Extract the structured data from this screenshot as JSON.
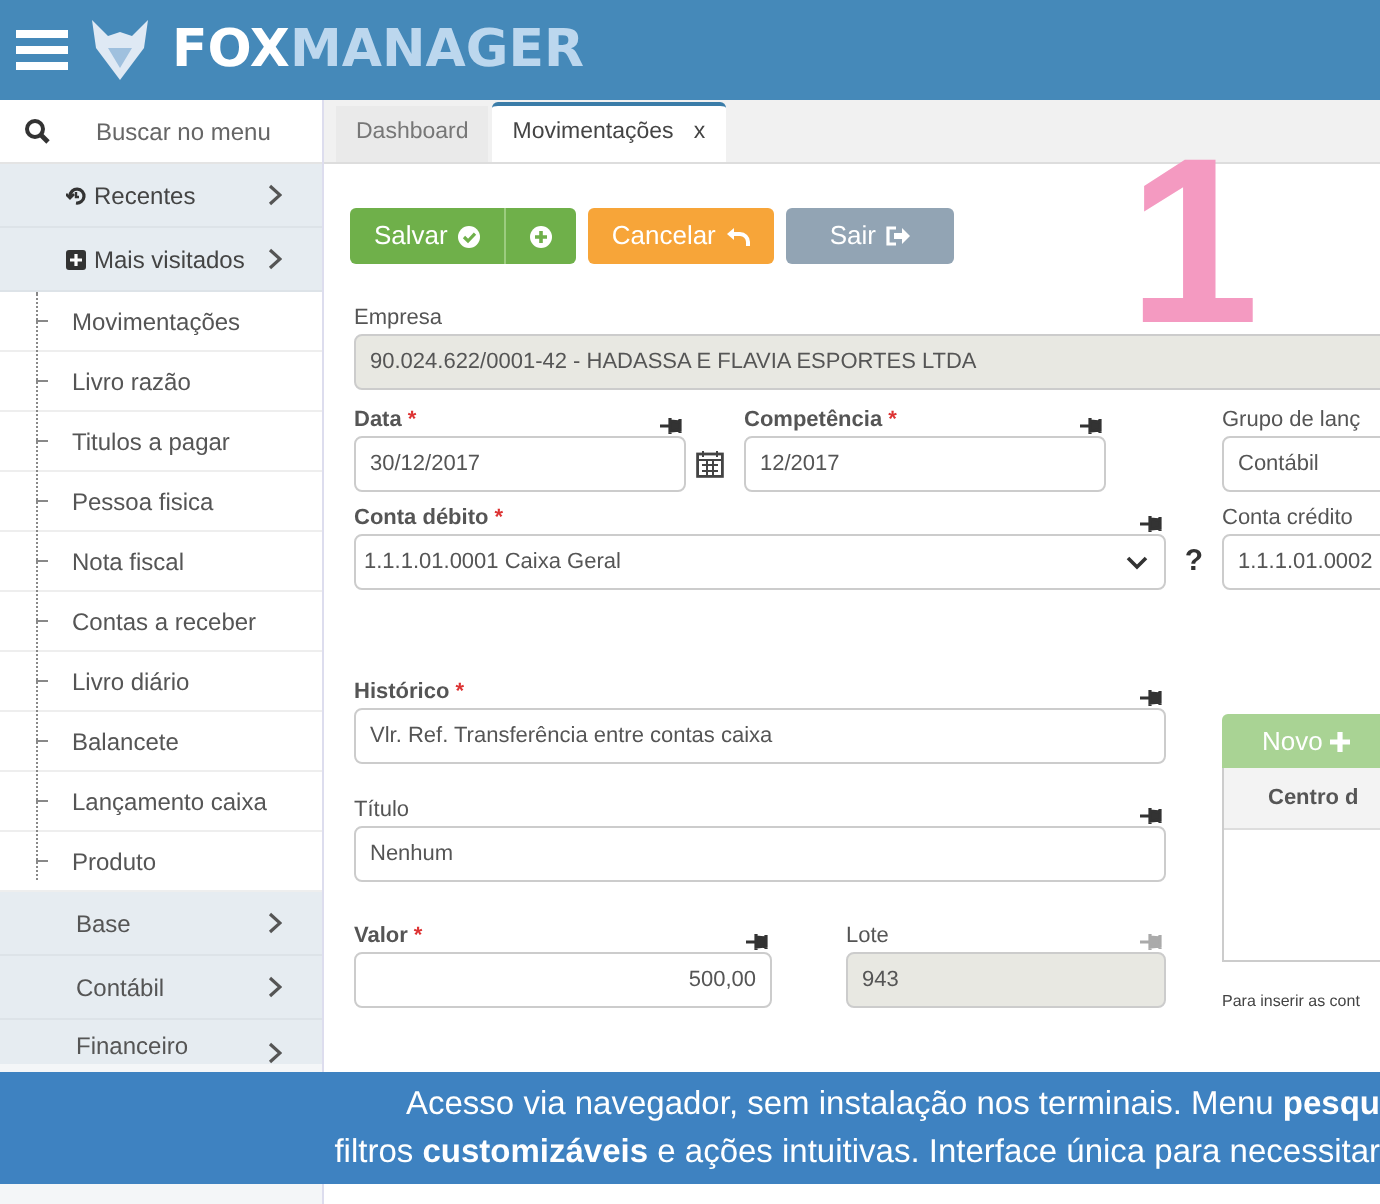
{
  "header": {
    "logo": {
      "text_1": "FOX",
      "text_2": "MANAGER"
    }
  },
  "sidebar": {
    "search_placeholder": "Buscar no menu",
    "groups": [
      {
        "label": "Recentes",
        "kind": "recent"
      },
      {
        "label": "Mais visitados",
        "kind": "frequent"
      }
    ],
    "tree_items": [
      "Movimentações",
      "Livro razão",
      "Titulos a pagar",
      "Pessoa fisica",
      "Nota fiscal",
      "Contas a receber",
      "Livro diário",
      "Balancete",
      "Lançamento caixa",
      "Produto"
    ],
    "bottom_items": [
      "Base",
      "Contábil",
      "Financeiro"
    ]
  },
  "tabs": [
    {
      "label": "Dashboard",
      "selected": false
    },
    {
      "label": "Movimentações",
      "selected": true,
      "close": "x"
    }
  ],
  "toolbar": [
    {
      "label": "Salvar",
      "kind": "save"
    },
    {
      "kind": "add"
    },
    {
      "label": "Cancelar",
      "kind": "cancel"
    },
    {
      "label": "Sair",
      "kind": "exit"
    }
  ],
  "step_number": "1",
  "form": {
    "empresa": {
      "label": "Empresa",
      "value": "90.024.622/0001-42 - HADASSA E FLAVIA ESPORTES LTDA",
      "readonly": true
    },
    "data": {
      "label": "Data",
      "required_mark": "*",
      "value": "30/12/2017",
      "readonly": false,
      "pinned": true
    },
    "competencia": {
      "label": "Competência",
      "required_mark": "*",
      "value": "12/2017",
      "readonly": false,
      "pinned": true
    },
    "grupo": {
      "label": "Grupo de lanç",
      "value": "Contábil",
      "readonly": false
    },
    "conta_debito": {
      "label": "Conta débito",
      "required_mark": "*",
      "value": "1.1.1.01.0001 Caixa Geral",
      "readonly": false,
      "pinned": true
    },
    "help_mark": "?",
    "conta_credito": {
      "label": "Conta crédito",
      "value": "1.1.1.01.0002",
      "readonly": false
    },
    "historico": {
      "label": "Histórico",
      "required_mark": "*",
      "value": "Vlr. Ref. Transferência entre contas caixa",
      "readonly": false,
      "pinned": true
    },
    "titulo": {
      "label": "Título",
      "value": "Nenhum",
      "readonly": false,
      "pinned": true
    },
    "valor": {
      "label": "Valor",
      "required_mark": "*",
      "value": "500,00",
      "readonly": false,
      "pinned": true
    },
    "lote": {
      "label": "Lote",
      "value": "943",
      "readonly": true,
      "pinned": false
    }
  },
  "cost_centers": {
    "button": "Novo",
    "disabled": true,
    "column": "Centro d",
    "note": "Para inserir as cont"
  },
  "caption": {
    "lines": [
      "Acesso via navegador, sem instalação nos terminais. Menu **pesqu**",
      "filtros **customizáveis** e ações intuitivas. Interface única para necessitar"
    ]
  }
}
